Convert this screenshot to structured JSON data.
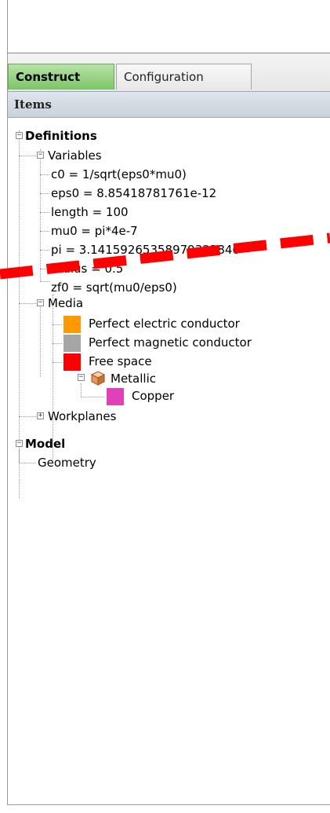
{
  "tabs": [
    {
      "label": "Construct",
      "active": true
    },
    {
      "label": "Configuration",
      "active": false
    }
  ],
  "panel": {
    "header": "Items"
  },
  "tree": {
    "definitions": "Definitions",
    "variables": "Variables",
    "variable_items": [
      "c0 = 1/sqrt(eps0*mu0)",
      "eps0 = 8.85418781761e-12",
      "length = 100",
      "mu0 = pi*4e-7",
      "pi = 3.14159265358979323846",
      "radius = 0.5",
      "zf0 = sqrt(mu0/eps0)"
    ],
    "media": "Media",
    "media_items": [
      {
        "label": "Perfect electric conductor",
        "color": "#ff9900"
      },
      {
        "label": "Perfect magnetic conductor",
        "color": "#a6a6a6"
      },
      {
        "label": "Free space",
        "color": "#ff0000"
      }
    ],
    "metallic": "Metallic",
    "copper": {
      "label": "Copper",
      "color": "#e040b8"
    },
    "workplanes": "Workplanes",
    "model": "Model",
    "geometry": "Geometry"
  },
  "annotation": {
    "color": "#ff0000",
    "style": "dashed"
  }
}
